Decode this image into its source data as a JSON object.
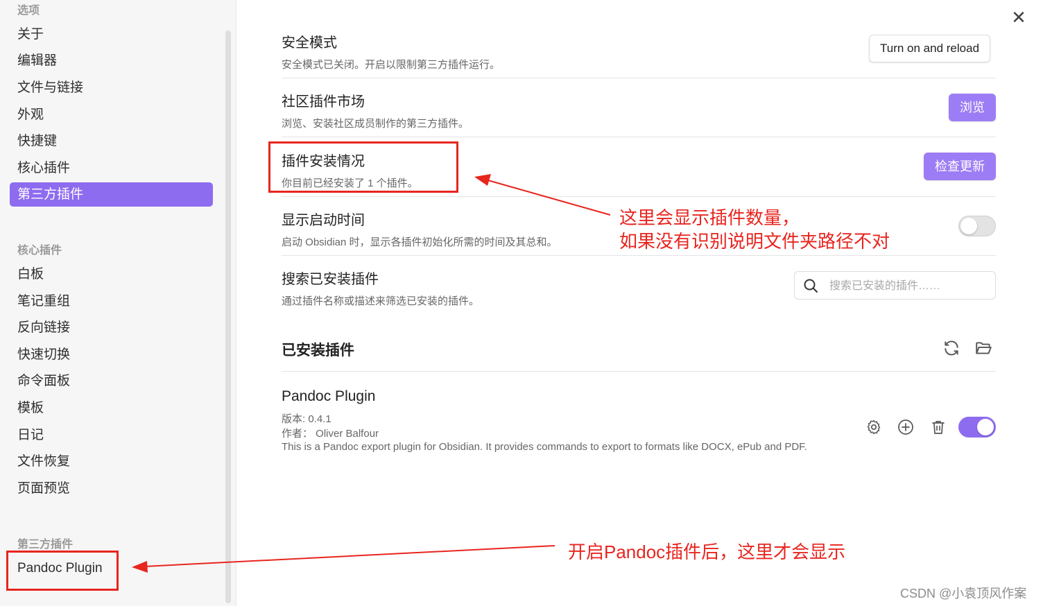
{
  "sidebar": {
    "top_label": "选项",
    "options_items": [
      {
        "label": "关于",
        "active": false
      },
      {
        "label": "编辑器",
        "active": false
      },
      {
        "label": "文件与链接",
        "active": false
      },
      {
        "label": "外观",
        "active": false
      },
      {
        "label": "快捷键",
        "active": false
      },
      {
        "label": "核心插件",
        "active": false
      },
      {
        "label": "第三方插件",
        "active": true
      }
    ],
    "core_group_label": "核心插件",
    "core_items": [
      "白板",
      "笔记重组",
      "反向链接",
      "快速切换",
      "命令面板",
      "模板",
      "日记",
      "文件恢复",
      "页面预览"
    ],
    "third_party_group_label": "第三方插件",
    "third_party_items": [
      "Pandoc Plugin"
    ]
  },
  "settings": {
    "safe_mode": {
      "title": "安全模式",
      "desc": "安全模式已关闭。开启以限制第三方插件运行。",
      "button": "Turn on and reload"
    },
    "community": {
      "title": "社区插件市场",
      "desc": "浏览、安装社区成员制作的第三方插件。",
      "button": "浏览"
    },
    "install_status": {
      "title": "插件安装情况",
      "desc": "你目前已经安装了 1 个插件。",
      "button": "检查更新"
    },
    "startup_time": {
      "title": "显示启动时间",
      "desc": "启动 Obsidian 时，显示各插件初始化所需的时间及其总和。",
      "toggle_on": false
    },
    "search": {
      "title": "搜索已安装插件",
      "desc": "通过插件名称或描述来筛选已安装的插件。",
      "placeholder": "搜索已安装的插件……"
    }
  },
  "installed": {
    "heading": "已安装插件",
    "plugins": [
      {
        "name": "Pandoc Plugin",
        "version": "版本: 0.4.1",
        "author": "作者：  Oliver Balfour",
        "desc": "This is a Pandoc export plugin for Obsidian. It provides commands to export to formats like DOCX, ePub and PDF.",
        "enabled": true
      }
    ]
  },
  "annotations": {
    "note1_line1": "这里会显示插件数量，",
    "note1_line2": "如果没有识别说明文件夹路径不对",
    "note2": "开启Pandoc插件后，这里才会显示",
    "color": "#e8251f"
  },
  "watermark": "CSDN @小袁顶风作案",
  "colors": {
    "accent": "#8e6cf0",
    "accent_button": "#9d7df5"
  },
  "icons": [
    "close-icon",
    "search-icon",
    "reload-icon",
    "folder-icon",
    "gear-icon",
    "plus-circle-icon",
    "trash-icon"
  ]
}
